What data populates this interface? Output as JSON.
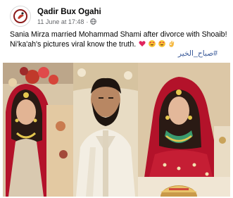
{
  "post": {
    "author": "Qadir Bux Ogahi",
    "timestamp": "11 June at 17:48",
    "separator": "·",
    "privacy_icon": "globe-icon",
    "avatar_icon": "page-logo",
    "text_line1": "Sania Mirza married Mohammad Shami after divorce with Shoaib!",
    "text_line2": "Ni'ka'ah's pictures viral know the truth.",
    "emojis": [
      "red-heart",
      "heart-eyes-face",
      "heart-eyes-face",
      "ok-hand"
    ],
    "hashtag": "#صباح_الخير"
  },
  "colors": {
    "link": "#385898",
    "secondary_text": "#65676b",
    "bride_dress": "#b3122a",
    "emoji_heart": "#e0245e",
    "emoji_face": "#f7c231"
  },
  "photo": {
    "description_icon": "collage-photo",
    "panels": [
      "bride-left",
      "groom-center",
      "bride-right",
      "bottom-inset"
    ]
  }
}
